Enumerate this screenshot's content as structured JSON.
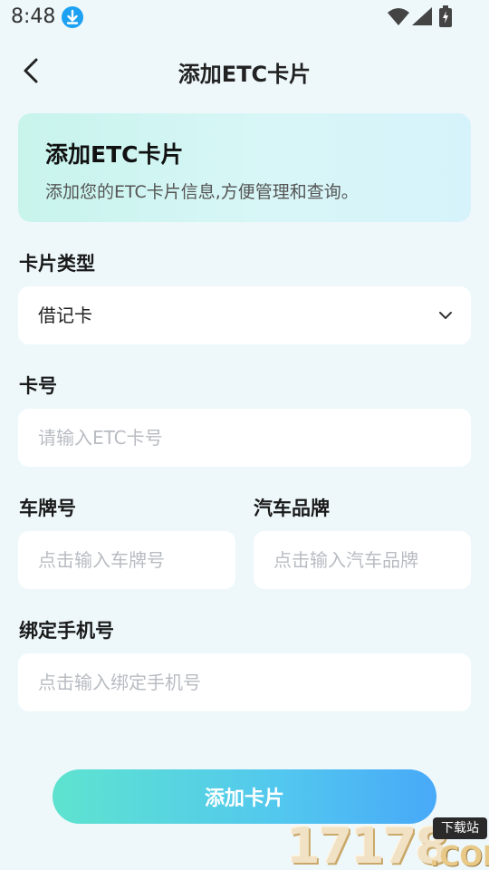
{
  "status_bar": {
    "time": "8:48"
  },
  "nav": {
    "title": "添加ETC卡片"
  },
  "banner": {
    "title": "添加ETC卡片",
    "description": "添加您的ETC卡片信息,方便管理和查询。"
  },
  "form": {
    "card_type": {
      "label": "卡片类型",
      "value": "借记卡"
    },
    "card_number": {
      "label": "卡号",
      "placeholder": "请输入ETC卡号"
    },
    "plate": {
      "label": "车牌号",
      "placeholder": "点击输入车牌号"
    },
    "brand": {
      "label": "汽车品牌",
      "placeholder": "点击输入汽车品牌"
    },
    "phone": {
      "label": "绑定手机号",
      "placeholder": "点击输入绑定手机号"
    }
  },
  "submit": {
    "label": "添加卡片"
  },
  "watermark": {
    "digits": "17178",
    "badge": "下载站",
    "suffix": ".COM"
  },
  "colors": {
    "background": "#eef8fb",
    "banner_gradient_start": "#c8f4ec",
    "banner_gradient_end": "#d6f3fb",
    "button_gradient_start": "#5ee3cf",
    "button_gradient_end": "#48a9f8",
    "placeholder": "#b8bcc2"
  }
}
